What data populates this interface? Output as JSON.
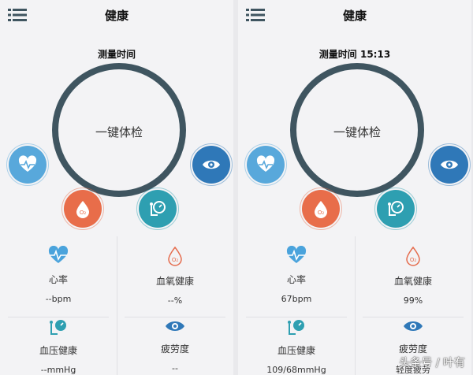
{
  "colors": {
    "ring": "#3f5560",
    "heart_button": "#58a8db",
    "blood_button": "#e86d4a",
    "bp_button": "#2e9fb1",
    "eye_button": "#2f78b8"
  },
  "panels": [
    {
      "title": "健康",
      "measure_time": "测量时间",
      "one_key_check": "一键体检",
      "stats": [
        {
          "label": "心率",
          "value": "--bpm",
          "icon": "heartbeat-icon"
        },
        {
          "label": "血氧健康",
          "value": "--%",
          "icon": "blood-drop-icon"
        },
        {
          "label": "血压健康",
          "value": "--mmHg",
          "icon": "blood-pressure-gauge-icon"
        },
        {
          "label": "疲劳度",
          "value": "--",
          "icon": "eye-icon"
        }
      ]
    },
    {
      "title": "健康",
      "measure_time": "测量时间 15:13",
      "one_key_check": "一键体检",
      "stats": [
        {
          "label": "心率",
          "value": "67bpm",
          "icon": "heartbeat-icon"
        },
        {
          "label": "血氧健康",
          "value": "99%",
          "icon": "blood-drop-icon"
        },
        {
          "label": "血压健康",
          "value": "109/68mmHg",
          "icon": "blood-pressure-gauge-icon"
        },
        {
          "label": "疲劳度",
          "value": "轻度疲劳",
          "icon": "eye-icon"
        }
      ]
    }
  ],
  "watermark": "头条号 / 叶有"
}
